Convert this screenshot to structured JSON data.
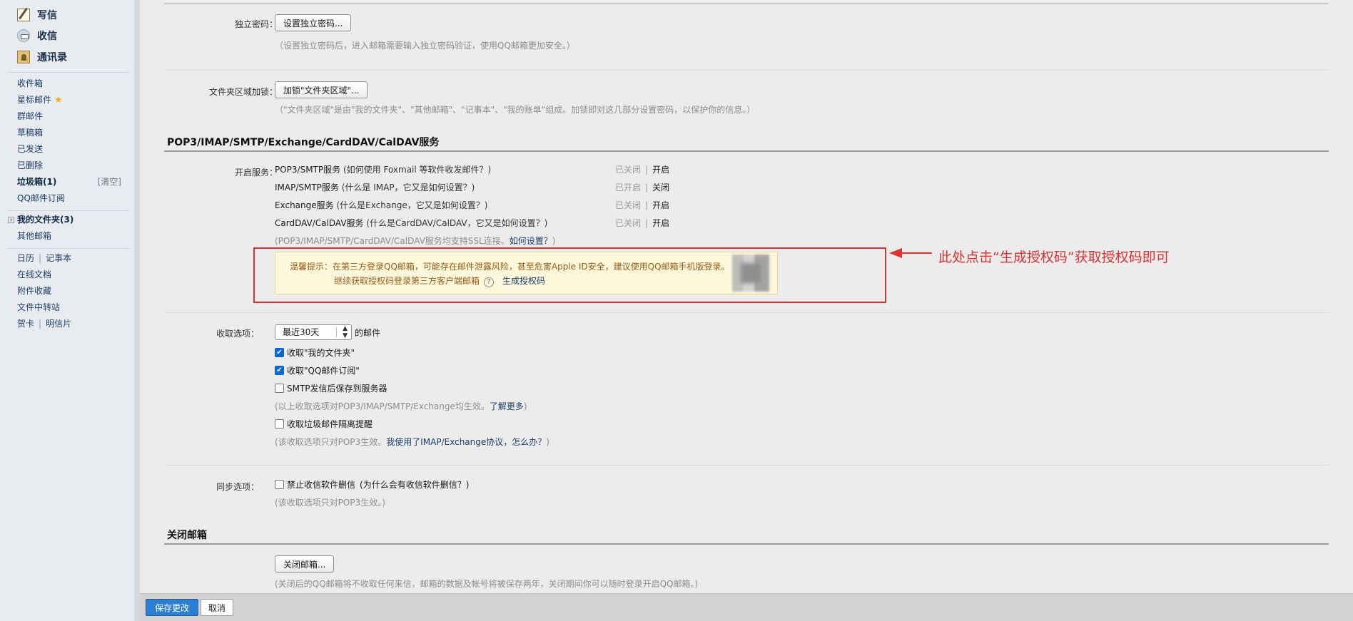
{
  "sidebar": {
    "compose": "写信",
    "inbox": "收信",
    "contacts": "通讯录",
    "folders": [
      "收件箱",
      "星标邮件",
      "群邮件",
      "草稿箱",
      "已发送",
      "已删除"
    ],
    "spam": "垃圾箱(1)",
    "spam_clear": "[清空]",
    "subscription": "QQ邮件订阅",
    "my_folders": "我的文件夹(3)",
    "other_mail": "其他邮箱",
    "calendar": "日历",
    "notes": "记事本",
    "online_docs": "在线文档",
    "attachments": "附件收藏",
    "file_transfer": "文件中转站",
    "cards": "贺卡",
    "postcard": "明信片"
  },
  "security": {
    "password_label": "独立密码：",
    "password_button": "设置独立密码...",
    "password_hint": "（设置独立密码后，进入邮箱需要输入独立密码验证，使用QQ邮箱更加安全。）",
    "folder_lock_label": "文件夹区域加锁：",
    "folder_lock_button": "加锁\"文件夹区域\"...",
    "folder_lock_hint": "（\"文件夹区域\"是由\"我的文件夹\"、\"其他邮箱\"、\"记事本\"、\"我的账单\"组成。加锁即对这几部分设置密码，以保护你的信息。）"
  },
  "services": {
    "title": "POP3/IMAP/SMTP/Exchange/CardDAV/CalDAV服务",
    "label": "开启服务：",
    "items": [
      {
        "name": "POP3/SMTP服务",
        "help": "(如何使用 Foxmail 等软件收发邮件？)",
        "status": "已关闭",
        "action": "开启"
      },
      {
        "name": "IMAP/SMTP服务",
        "help": "(什么是 IMAP，它又是如何设置？)",
        "status": "已开启",
        "action": "关闭"
      },
      {
        "name": "Exchange服务",
        "help": "(什么是Exchange，它又是如何设置？)",
        "status": "已关闭",
        "action": "开启"
      },
      {
        "name": "CardDAV/CalDAV服务",
        "help": "(什么是CardDAV/CalDAV，它又是如何设置？)",
        "status": "已关闭",
        "action": "开启"
      }
    ],
    "ssl_hint": "(POP3/IMAP/SMTP/CardDAV/CalDAV服务均支持SSL连接。",
    "ssl_link": "如何设置？",
    "ssl_hint_end": ")",
    "tip_line1": "温馨提示：在第三方登录QQ邮箱，可能存在邮件泄露风险，甚至危害Apple ID安全，建议使用QQ邮箱手机版登录。",
    "tip_line2": "继续获取授权码登录第三方客户端邮箱",
    "tip_q": "?",
    "tip_generate": "生成授权码",
    "annotation": "此处点击“生成授权码”获取授权码即可"
  },
  "receive": {
    "label": "收取选项：",
    "range_value": "最近30天",
    "range_suffix": "的邮件",
    "opt1": "收取\"我的文件夹\"",
    "opt2": "收取\"QQ邮件订阅\"",
    "opt3": "SMTP发信后保存到服务器",
    "hint1": "(以上收取选项对POP3/IMAP/SMTP/Exchange均生效。",
    "hint1_link": "了解更多",
    "hint1_end": ")",
    "opt4": "收取垃圾邮件隔离提醒",
    "hint2": "(该收取选项只对POP3生效。",
    "hint2_link": "我使用了IMAP/Exchange协议，怎么办？",
    "hint2_end": ")"
  },
  "sync": {
    "label": "同步选项：",
    "opt": "禁止收信软件删信",
    "opt_help": "(为什么会有收信软件删信？)",
    "hint": "(该收取选项只对POP3生效。)"
  },
  "close_mail": {
    "title": "关闭邮箱",
    "button": "关闭邮箱...",
    "hint": "(关闭后的QQ邮箱将不收取任何来信，邮箱的数据及帐号将被保存两年，关闭期间你可以随时登录开启QQ邮箱。)"
  },
  "footer": {
    "save": "保存更改",
    "cancel": "取消"
  },
  "colors": {
    "accent": "#2a7fd4",
    "annotation_red": "#e03030",
    "tip_bg": "#fdf8dc"
  }
}
